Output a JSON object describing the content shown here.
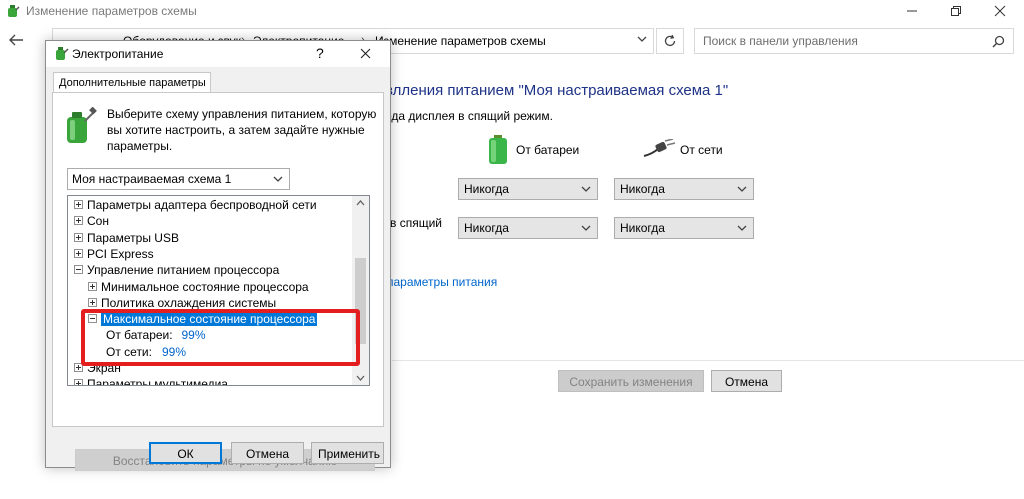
{
  "window": {
    "title": "Изменение параметров схемы"
  },
  "address": {
    "segments": [
      "Оборудование и звук",
      "Электропитание",
      "Изменение параметров схемы"
    ]
  },
  "search": {
    "placeholder": "Поиск в панели управления"
  },
  "background": {
    "heading": "влления питанием \"Моя настраиваемая схема 1\"",
    "subtitle": "рда дисплея в спящий режим.",
    "col_battery": "От батареи",
    "col_ac": "От сети",
    "row2_label": "в спящий",
    "dropdown_value": "Никогда",
    "link": "параметры питания",
    "save_button": "Сохранить изменения",
    "cancel_button": "Отмена"
  },
  "dialog": {
    "title": "Электропитание",
    "help": "?",
    "tab": "Дополнительные параметры",
    "description": "Выберите схему управления питанием, которую вы хотите настроить, а затем задайте нужные параметры.",
    "scheme": "Моя настраиваемая схема 1",
    "tree": [
      {
        "label": "Параметры адаптера беспроводной сети",
        "level": 0,
        "state": "collapsed"
      },
      {
        "label": "Сон",
        "level": 0,
        "state": "collapsed"
      },
      {
        "label": "Параметры USB",
        "level": 0,
        "state": "collapsed"
      },
      {
        "label": "PCI Express",
        "level": 0,
        "state": "collapsed"
      },
      {
        "label": "Управление питанием процессора",
        "level": 0,
        "state": "expanded"
      },
      {
        "label": "Минимальное состояние процессора",
        "level": 1,
        "state": "collapsed"
      },
      {
        "label": "Политика охлаждения системы",
        "level": 1,
        "state": "collapsed"
      },
      {
        "label": "Максимальное состояние процессора",
        "level": 1,
        "state": "expanded",
        "selected": true
      },
      {
        "label": "От батареи:",
        "value": "99%",
        "level": 2,
        "state": "leaf"
      },
      {
        "label": "От сети:",
        "value": "99%",
        "level": 2,
        "state": "leaf"
      },
      {
        "label": "Экран",
        "level": 0,
        "state": "collapsed"
      },
      {
        "label": "Параметры мультимедиа",
        "level": 0,
        "state": "collapsed"
      }
    ],
    "restore_button": "Восстановить параметры по умолчанию",
    "ok_button": "ОК",
    "cancel_button": "Отмена",
    "apply_button": "Применить"
  },
  "colors": {
    "accent": "#0078d7",
    "heading": "#1e3287",
    "link": "#0066cc",
    "highlight": "#e41e1e"
  }
}
